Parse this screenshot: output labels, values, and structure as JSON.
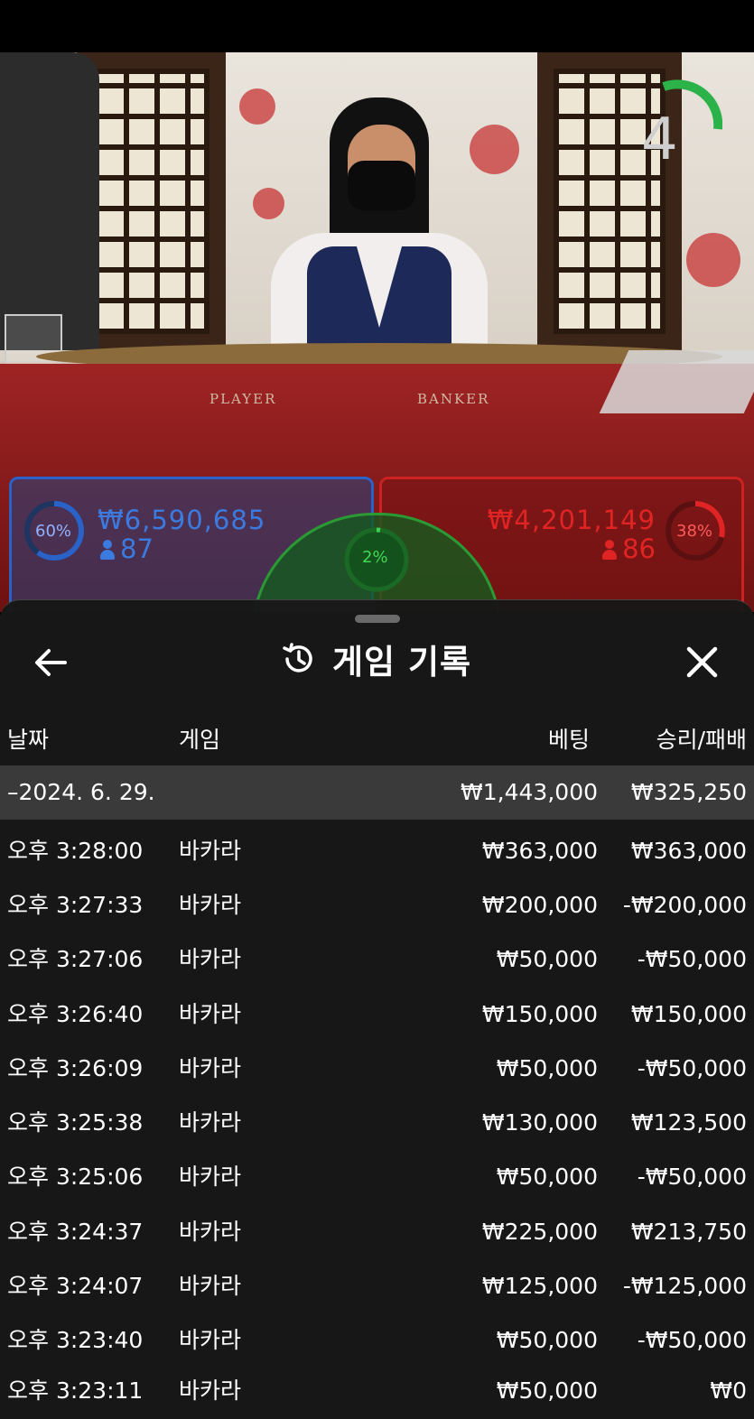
{
  "overlay": {
    "timer": "4",
    "player": {
      "percent": "60%",
      "amount": "₩6,590,685",
      "count": "87"
    },
    "banker": {
      "percent": "38%",
      "amount": "₩4,201,149",
      "count": "86"
    },
    "tie": {
      "percent": "2%"
    },
    "felt_labels": {
      "player": "PLAYER",
      "banker": "BANKER"
    }
  },
  "sheet": {
    "title": "게임 기록",
    "columns": {
      "date": "날짜",
      "game": "게임",
      "bet": "베팅",
      "result": "승리/패배"
    },
    "date_group": {
      "label": "–2024. 6. 29.",
      "bet_total": "₩1,443,000",
      "result_total": "₩325,250"
    },
    "rows": [
      {
        "time": "오후 3:28:00",
        "game": "바카라",
        "bet": "₩363,000",
        "result": "₩363,000"
      },
      {
        "time": "오후 3:27:33",
        "game": "바카라",
        "bet": "₩200,000",
        "result": "-₩200,000"
      },
      {
        "time": "오후 3:27:06",
        "game": "바카라",
        "bet": "₩50,000",
        "result": "-₩50,000"
      },
      {
        "time": "오후 3:26:40",
        "game": "바카라",
        "bet": "₩150,000",
        "result": "₩150,000"
      },
      {
        "time": "오후 3:26:09",
        "game": "바카라",
        "bet": "₩50,000",
        "result": "-₩50,000"
      },
      {
        "time": "오후 3:25:38",
        "game": "바카라",
        "bet": "₩130,000",
        "result": "₩123,500"
      },
      {
        "time": "오후 3:25:06",
        "game": "바카라",
        "bet": "₩50,000",
        "result": "-₩50,000"
      },
      {
        "time": "오후 3:24:37",
        "game": "바카라",
        "bet": "₩225,000",
        "result": "₩213,750"
      },
      {
        "time": "오후 3:24:07",
        "game": "바카라",
        "bet": "₩125,000",
        "result": "-₩125,000"
      },
      {
        "time": "오후 3:23:40",
        "game": "바카라",
        "bet": "₩50,000",
        "result": "-₩50,000"
      },
      {
        "time": "오후 3:23:11",
        "game": "바카라",
        "bet": "₩50,000",
        "result": "₩0"
      }
    ]
  },
  "colors": {
    "player": "#2a62c8",
    "banker": "#d02020",
    "tie": "#2a9a34",
    "timer": "#2bb34a"
  },
  "icons": {
    "back": "arrow-left-icon",
    "history": "history-icon",
    "close": "close-icon"
  }
}
